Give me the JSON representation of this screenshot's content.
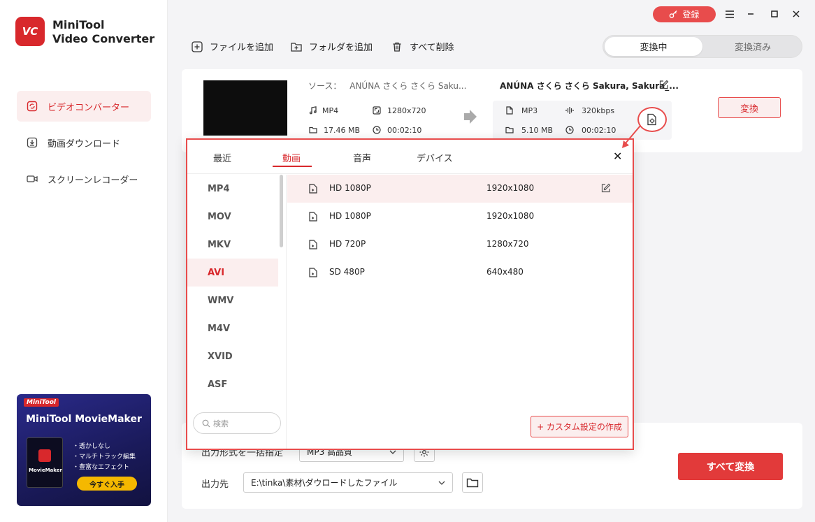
{
  "app": {
    "logo_text": "VC",
    "name_line1": "MiniTool",
    "name_line2": "Video Converter"
  },
  "sidebar": {
    "items": [
      {
        "label": "ビデオコンバーター",
        "icon": "convert-icon",
        "active": true
      },
      {
        "label": "動画ダウンロード",
        "icon": "download-icon",
        "active": false
      },
      {
        "label": "スクリーンレコーダー",
        "icon": "camera-icon",
        "active": false
      }
    ],
    "ad": {
      "brand": "MiniTool",
      "title": "MiniTool MovieMaker",
      "box_name": "MovieMaker",
      "features": [
        "・透かしなし",
        "・マルチトラック編集",
        "・豊富なエフェクト"
      ],
      "button": "今すぐ入手"
    }
  },
  "topbar": {
    "register": "登録",
    "menu_icon": "menu-icon",
    "minimize_icon": "minimize-icon",
    "maximize_icon": "maximize-icon",
    "close_icon": "close-icon"
  },
  "toolbar": {
    "add_file": "ファイルを追加",
    "add_folder": "フォルダを追加",
    "delete_all": "すべて削除"
  },
  "segment": {
    "converting": "変換中",
    "converted": "変換済み"
  },
  "file": {
    "source_prefix": "ソース：",
    "source_name": "ANÚNA さくら さくら Saku...",
    "format": "MP4",
    "resolution": "1280x720",
    "size": "17.46 MB",
    "duration": "00:02:10",
    "output_title": "ANÚNA さくら さくら Sakura, Sakura_...",
    "out_format": "MP3",
    "out_bitrate": "320kbps",
    "out_size": "5.10 MB",
    "out_duration": "00:02:10",
    "convert": "変換"
  },
  "dialog": {
    "tabs": [
      "最近",
      "動画",
      "音声",
      "デバイス"
    ],
    "active_tab": 1,
    "formats": [
      "MP4",
      "MOV",
      "MKV",
      "AVI",
      "WMV",
      "M4V",
      "XVID",
      "ASF"
    ],
    "active_format": "AVI",
    "search_placeholder": "検索",
    "presets": [
      {
        "name": "HD 1080P",
        "res": "1920x1080"
      },
      {
        "name": "HD 1080P",
        "res": "1920x1080"
      },
      {
        "name": "HD 720P",
        "res": "1280x720"
      },
      {
        "name": "SD 480P",
        "res": "640x480"
      }
    ],
    "custom": "+ カスタム設定の作成"
  },
  "bottom": {
    "format_label": "出力形式を一括指定",
    "format_value": "MP3 高品質",
    "dest_label": "出力先",
    "dest_value": "E:\\tinka\\素材\\ダウロードしたファイル",
    "convert_all": "すべて変換"
  },
  "colors": {
    "accent": "#e84c4c",
    "accent_dark": "#d8282c",
    "accent_light": "#fbeeee"
  }
}
